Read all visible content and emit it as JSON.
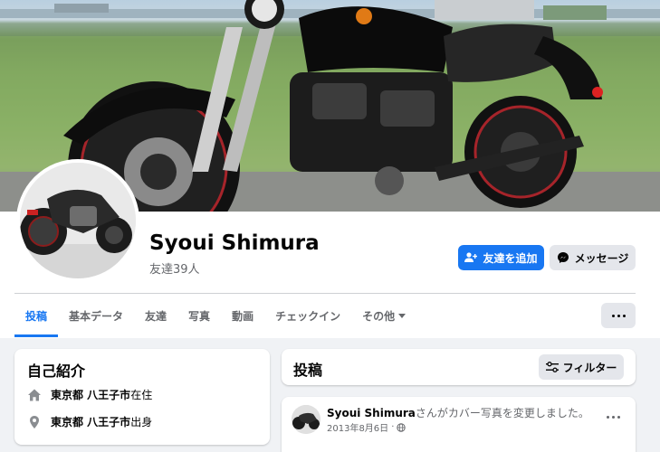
{
  "profile": {
    "name": "Syoui Shimura",
    "friends_count": "友達39人",
    "add_friend_label": "友達を追加",
    "message_label": "メッセージ"
  },
  "tabs": [
    {
      "label": "投稿",
      "active": true
    },
    {
      "label": "基本データ"
    },
    {
      "label": "友達"
    },
    {
      "label": "写真"
    },
    {
      "label": "動画"
    },
    {
      "label": "チェックイン"
    },
    {
      "label": "その他"
    }
  ],
  "intro": {
    "title": "自己紹介",
    "lives_in": {
      "place": "東京都 八王子市",
      "suffix": "在住"
    },
    "from": {
      "place": "東京都 八王子市",
      "suffix": "出身"
    }
  },
  "posts": {
    "title": "投稿",
    "filter_label": "フィルター",
    "first": {
      "author": "Syoui Shimura",
      "action": "さんがカバー写真を変更しました。",
      "date": "2013年8月6日",
      "separator": "·",
      "audience_icon": "globe-icon"
    }
  },
  "colors": {
    "accent": "#1877f2",
    "secondary_button": "#e4e6eb",
    "page_background": "#f0f2f5",
    "muted_text": "#65676b"
  }
}
